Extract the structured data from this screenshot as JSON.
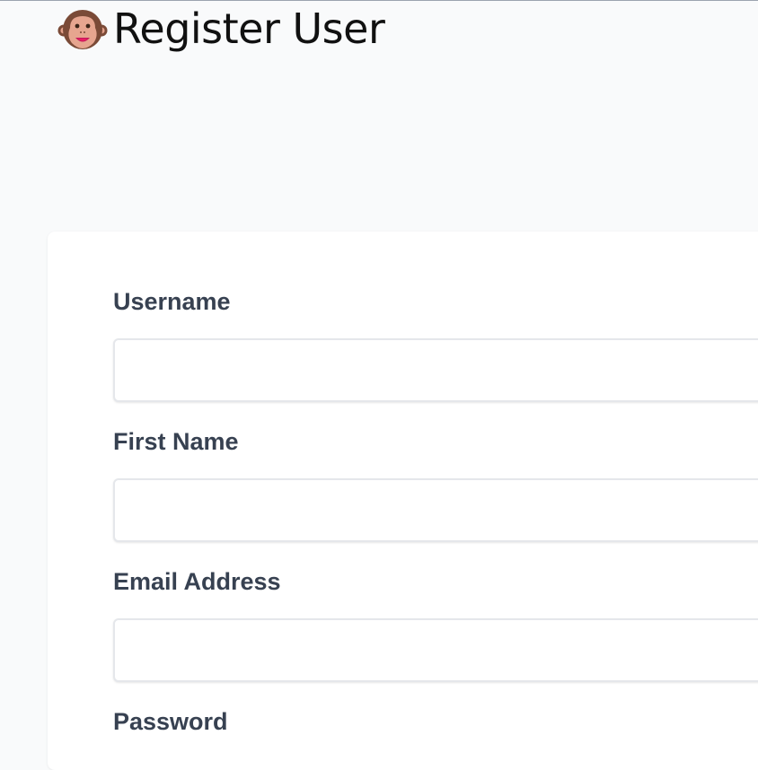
{
  "header": {
    "icon": "monkey-face-icon",
    "title": "Register User"
  },
  "form": {
    "fields": [
      {
        "label": "Username",
        "value": "",
        "placeholder": ""
      },
      {
        "label": "First Name",
        "value": "",
        "placeholder": ""
      },
      {
        "label": "Email Address",
        "value": "",
        "placeholder": ""
      },
      {
        "label": "Password"
      }
    ]
  },
  "colors": {
    "label_text": "#374151",
    "input_border": "#e5e7eb",
    "page_background": "#f9fafb",
    "card_background": "#ffffff"
  }
}
